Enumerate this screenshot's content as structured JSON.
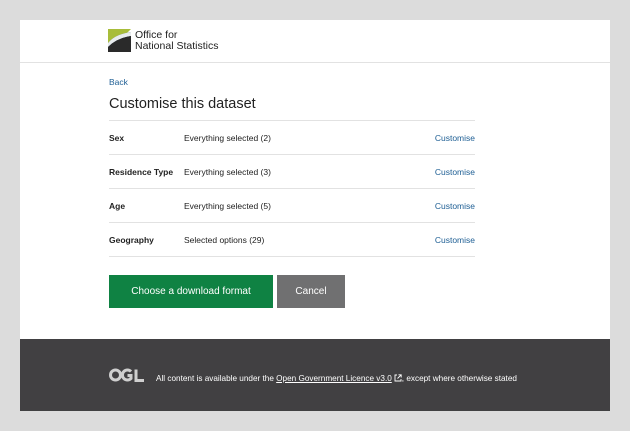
{
  "header": {
    "logo_line1": "Office for",
    "logo_line2": "National Statistics"
  },
  "nav": {
    "back_label": "Back"
  },
  "page": {
    "title": "Customise this dataset"
  },
  "dimensions": [
    {
      "name": "Sex",
      "selection": "Everything selected (2)",
      "action": "Customise"
    },
    {
      "name": "Residence Type",
      "selection": "Everything selected (3)",
      "action": "Customise"
    },
    {
      "name": "Age",
      "selection": "Everything selected (5)",
      "action": "Customise"
    },
    {
      "name": "Geography",
      "selection": "Selected options (29)",
      "action": "Customise"
    }
  ],
  "actions": {
    "primary_label": "Choose a download format",
    "cancel_label": "Cancel"
  },
  "footer": {
    "licence_prefix": "All content is available under the ",
    "licence_link": "Open Government Licence v3.0",
    "licence_suffix": ", except where otherwise stated"
  },
  "colors": {
    "link": "#206095",
    "primary_button": "#0f8243",
    "secondary_button": "#707071",
    "footer_bg": "#414042",
    "logo_green": "#a8bd3a",
    "logo_dark": "#003c57"
  }
}
